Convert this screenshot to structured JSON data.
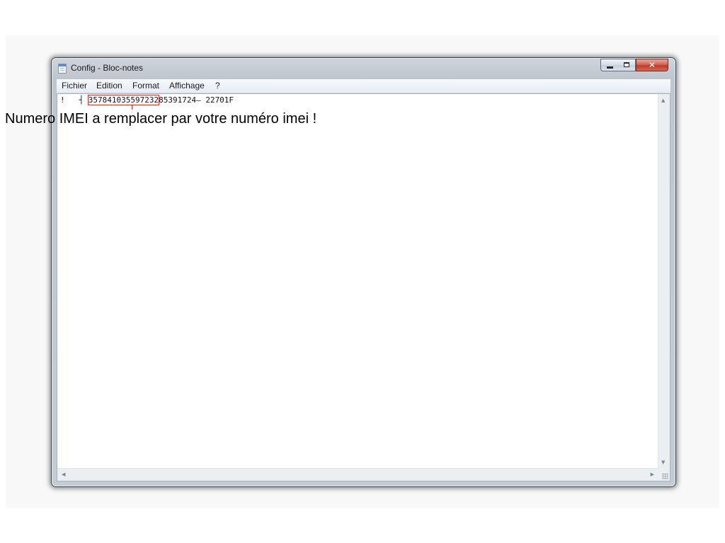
{
  "window": {
    "title": "Config - Bloc-notes",
    "close_symbol": "✕"
  },
  "menu": {
    "items": [
      {
        "label": "Fichier"
      },
      {
        "label": "Edition"
      },
      {
        "label": "Format"
      },
      {
        "label": "Affichage"
      },
      {
        "label": "?"
      }
    ]
  },
  "document": {
    "prefix": "!   ┤ ",
    "imei": "357841035597232",
    "suffix": "85391724– 22701F"
  },
  "annotation": {
    "text": "Numero IMEI a remplacer par votre numéro imei !"
  },
  "colors": {
    "highlight": "#c0322b",
    "close_button": "#c1392a"
  },
  "icons": {
    "app": "notepad-icon",
    "minimize": "minimize-icon",
    "maximize": "maximize-icon",
    "close": "close-icon"
  }
}
